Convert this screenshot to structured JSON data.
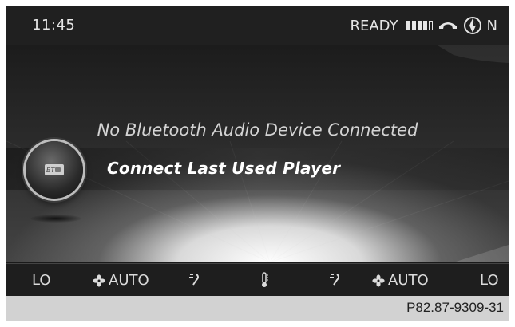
{
  "status_bar": {
    "time": "11:45",
    "ready_label": "READY",
    "signal_strength_bars": 4,
    "signal_max_bars": 5,
    "compass_direction": "N",
    "icons": [
      "signal-strength-icon",
      "phone-icon",
      "compass-icon"
    ]
  },
  "main": {
    "message": "No Bluetooth Audio Device Connected",
    "menu_item": "Connect Last Used Player",
    "bt_icon_text": "BT"
  },
  "climate": {
    "left_temp": "LO",
    "left_fan": "AUTO",
    "right_fan": "AUTO",
    "right_temp": "LO",
    "icons": [
      "fan-icon",
      "air-distribution-icon",
      "temperature-icon",
      "air-distribution-icon",
      "fan-icon"
    ]
  },
  "caption": {
    "ref_code": "P82.87-9309-31"
  },
  "colors": {
    "screen_bg": "#1a1a1a",
    "text_light": "#e6e6e6",
    "caption_bg": "#d2d2d2"
  }
}
